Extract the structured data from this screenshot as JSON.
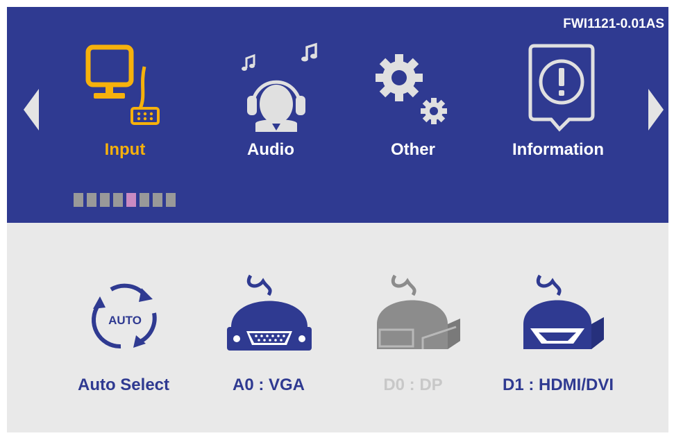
{
  "header": {
    "version": "FWI1121-0.01AS"
  },
  "colors": {
    "panel_blue": "#2f3a91",
    "panel_gray": "#e9e9e9",
    "active_yellow": "#f6b10c",
    "indicator_active": "#c98ac2",
    "indicator_inactive": "#999999",
    "disabled_gray": "#c8c8c8"
  },
  "menu": {
    "tabs": [
      {
        "label": "Input",
        "icon": "monitor-input-icon",
        "active": true
      },
      {
        "label": "Audio",
        "icon": "headset-icon",
        "active": false
      },
      {
        "label": "Other",
        "icon": "gears-icon",
        "active": false
      },
      {
        "label": "Information",
        "icon": "info-bubble-icon",
        "active": false
      }
    ],
    "nav": {
      "left_icon": "triangle-left-icon",
      "right_icon": "triangle-right-icon"
    },
    "page_indicator": {
      "total": 8,
      "active_index": 4
    }
  },
  "sources": [
    {
      "label": "Auto Select",
      "icon": "auto-cycle-icon",
      "enabled": true,
      "badge": "AUTO"
    },
    {
      "label": "A0 : VGA",
      "icon": "vga-connector-icon",
      "enabled": true
    },
    {
      "label": "D0 : DP",
      "icon": "displayport-connector-icon",
      "enabled": false
    },
    {
      "label": "D1 : HDMI/DVI",
      "icon": "hdmi-connector-icon",
      "enabled": true
    }
  ]
}
